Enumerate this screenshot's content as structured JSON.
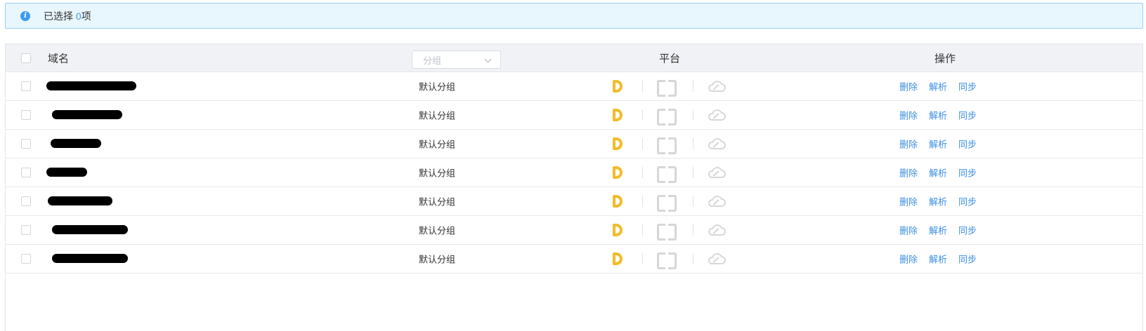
{
  "selection": {
    "prefix": "已选择 ",
    "count": "0",
    "suffix": "项"
  },
  "table": {
    "headers": {
      "domain": "域名",
      "group_placeholder": "分组",
      "platform": "平台",
      "operations": "操作"
    },
    "rows": [
      {
        "group": "默认分组",
        "ops": [
          "删除",
          "解析",
          "同步"
        ]
      },
      {
        "group": "默认分组",
        "ops": [
          "删除",
          "解析",
          "同步"
        ]
      },
      {
        "group": "默认分组",
        "ops": [
          "删除",
          "解析",
          "同步"
        ]
      },
      {
        "group": "默认分组",
        "ops": [
          "删除",
          "解析",
          "同步"
        ]
      },
      {
        "group": "默认分组",
        "ops": [
          "删除",
          "解析",
          "同步"
        ]
      },
      {
        "group": "默认分组",
        "ops": [
          "删除",
          "解析",
          "同步"
        ]
      },
      {
        "group": "默认分组",
        "ops": [
          "删除",
          "解析",
          "同步"
        ]
      }
    ]
  },
  "icons": {
    "info": "info-icon",
    "platform_1": "dnspod-icon",
    "platform_2": "bracket-icon",
    "platform_3": "cloud-icon"
  },
  "colors": {
    "link": "#3d8fe3",
    "accent": "#3d9cf0",
    "platform_active": "#f1bc2a",
    "platform_inactive": "#d6d7d9"
  }
}
